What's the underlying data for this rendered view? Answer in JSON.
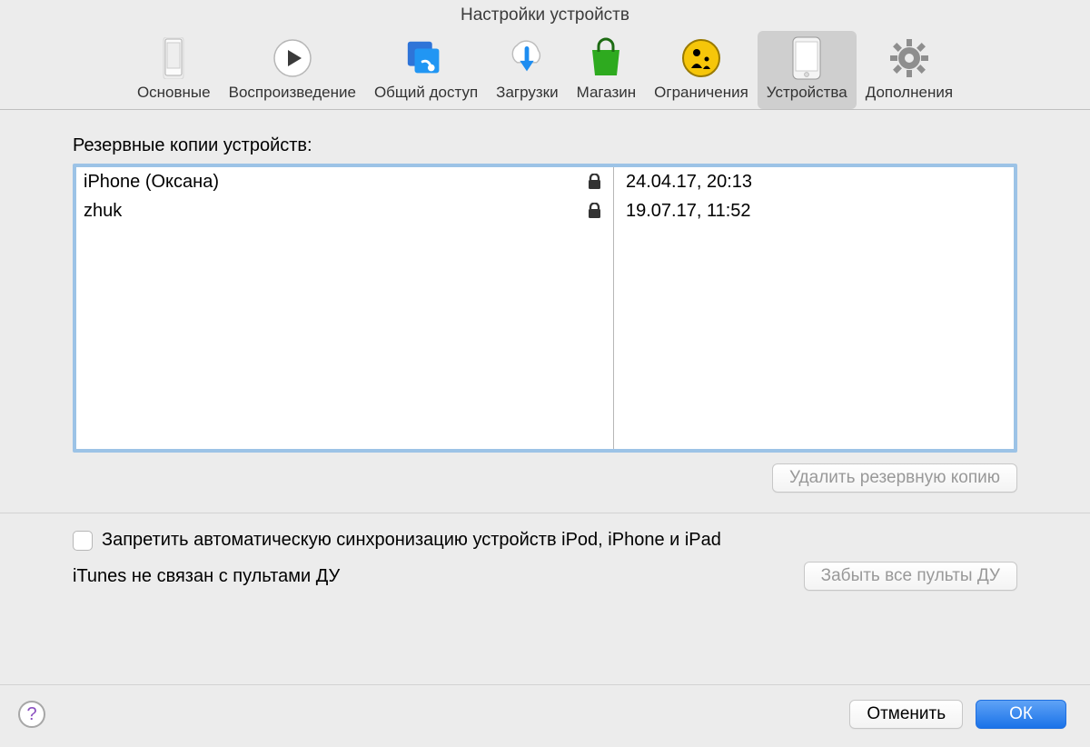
{
  "window": {
    "title": "Настройки устройств"
  },
  "toolbar": {
    "items": [
      {
        "id": "general",
        "label": "Основные"
      },
      {
        "id": "playback",
        "label": "Воспроизведение"
      },
      {
        "id": "sharing",
        "label": "Общий доступ"
      },
      {
        "id": "downloads",
        "label": "Загрузки"
      },
      {
        "id": "store",
        "label": "Магазин"
      },
      {
        "id": "restrictions",
        "label": "Ограничения"
      },
      {
        "id": "devices",
        "label": "Устройства"
      },
      {
        "id": "advanced",
        "label": "Дополнения"
      }
    ],
    "selected": "devices"
  },
  "backups": {
    "heading": "Резервные копии устройств:",
    "rows": [
      {
        "name": "iPhone (Оксана)",
        "encrypted": true,
        "date": "24.04.17, 20:13"
      },
      {
        "name": "zhuk",
        "encrypted": true,
        "date": "19.07.17, 11:52"
      }
    ],
    "delete_button": "Удалить резервную копию"
  },
  "options": {
    "prevent_sync_label": "Запретить автоматическую синхронизацию устройств iPod, iPhone и iPad",
    "prevent_sync_checked": false,
    "remotes_status": "iTunes не связан с пультами ДУ",
    "forget_remotes_button": "Забыть все пульты ДУ"
  },
  "footer": {
    "cancel": "Отменить",
    "ok": "ОК",
    "help": "?"
  }
}
